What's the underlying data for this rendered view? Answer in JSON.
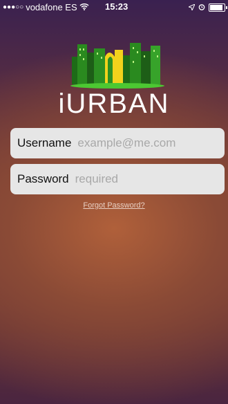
{
  "status_bar": {
    "signal": "●●●○○",
    "carrier": "vodafone ES",
    "wifi_icon": "wifi-icon",
    "time": "15:23",
    "location_icon": "location-arrow-icon",
    "alarm_icon": "alarm-icon",
    "battery_level": 0.9
  },
  "app": {
    "logo_text": "iURBAN"
  },
  "login": {
    "username_label": "Username",
    "username_placeholder": "example@me.com",
    "username_value": "",
    "password_label": "Password",
    "password_placeholder": "required",
    "password_value": "",
    "forgot_label": "Forgot Password?"
  },
  "colors": {
    "field_bg": "#e6e6e6",
    "placeholder": "#a8a8a8",
    "logo_green": "#4cc832",
    "logo_yellow": "#f2d21c"
  }
}
